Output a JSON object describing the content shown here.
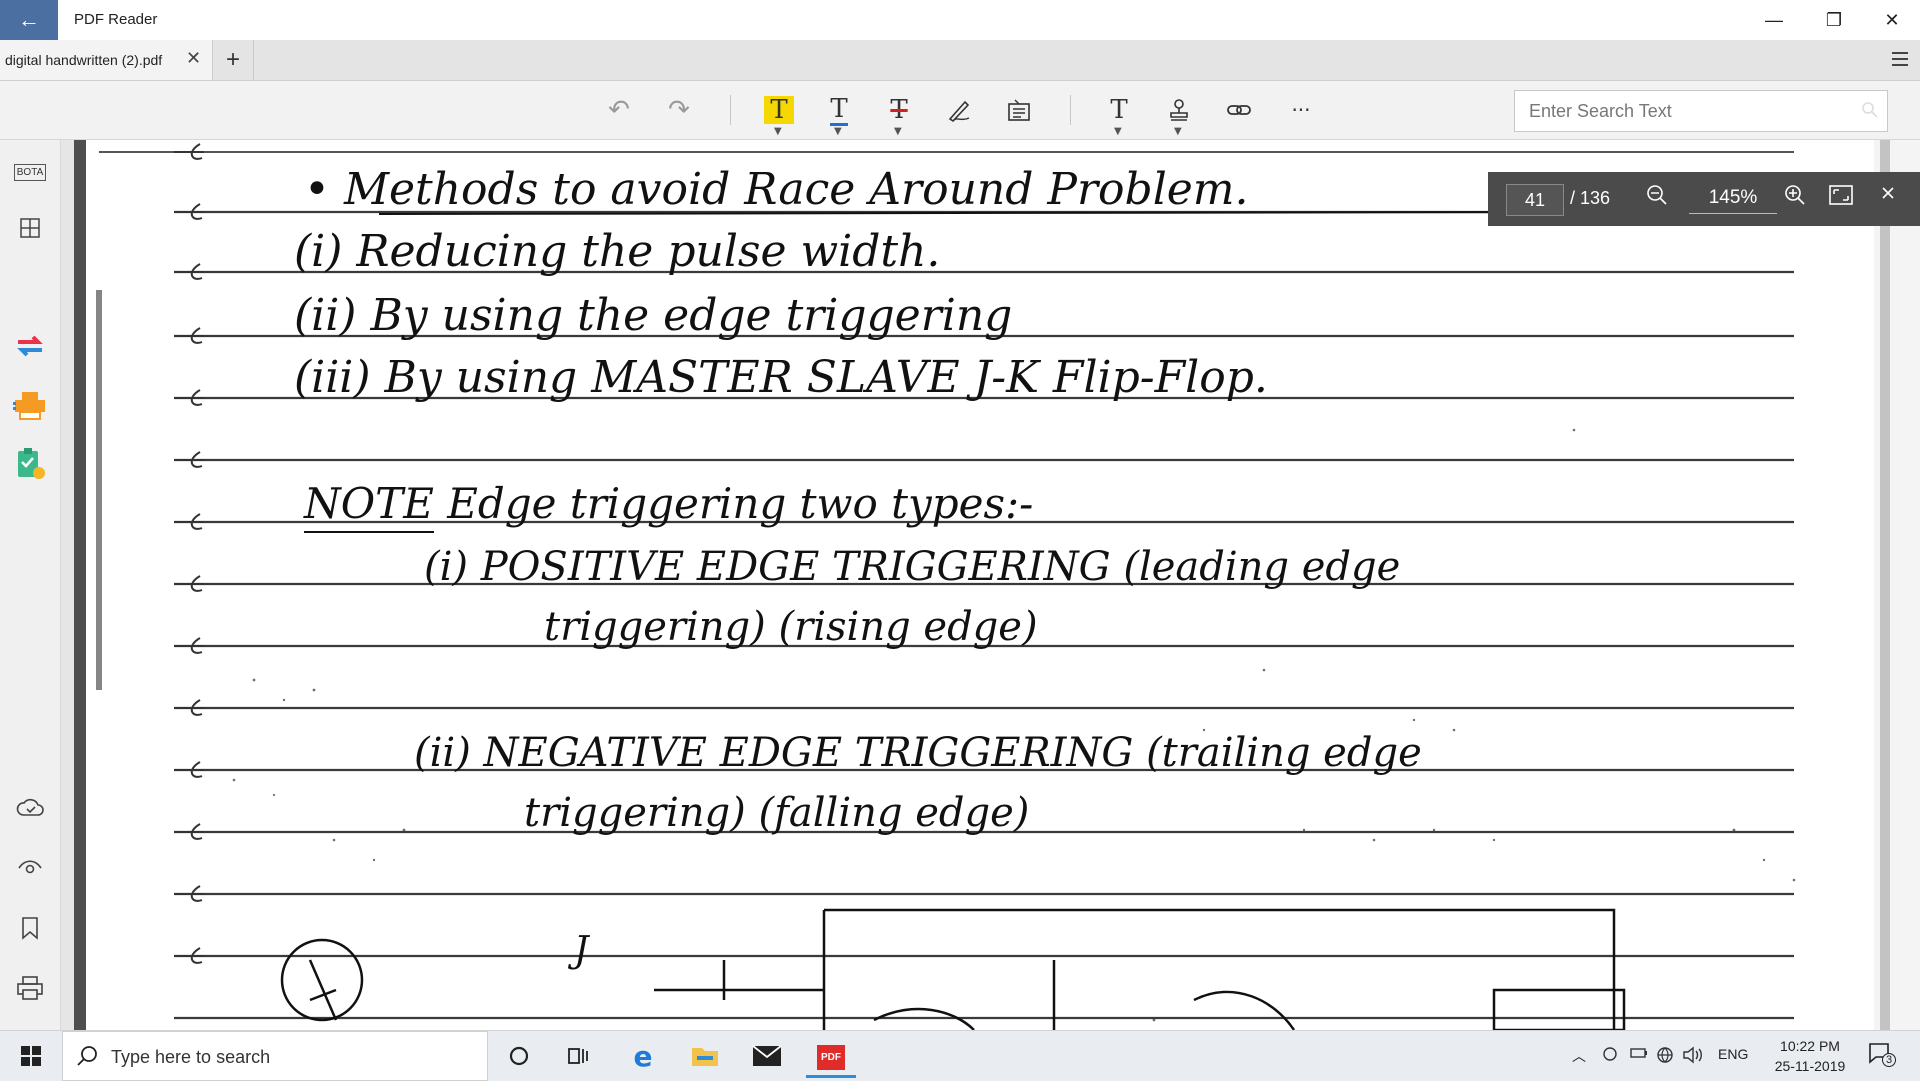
{
  "app": {
    "title": "PDF Reader",
    "back_glyph": "←"
  },
  "window_controls": {
    "minimize": "—",
    "maximize": "❐",
    "close": "✕"
  },
  "tabs": [
    {
      "label": "digital handwritten (2).pdf",
      "close": "✕"
    }
  ],
  "tab_add": "+",
  "toolbar": {
    "undo": "↶",
    "redo": "↷",
    "highlight": "T",
    "underline": "T",
    "strikethrough": "T",
    "text": "T",
    "more": "···",
    "colors": {
      "highlight": "#f5d800",
      "underline": "#1f6fd6",
      "strikethrough": "#d61f1f"
    }
  },
  "search": {
    "placeholder": "Enter Search Text"
  },
  "sidebar": {
    "bota": "BOTA"
  },
  "page_nav": {
    "current_page": "41",
    "total_pages": "/ 136",
    "zoom": "145%"
  },
  "document": {
    "lines": [
      "• Methods to avoid Race Around Problem.",
      "(i) Reducing the pulse width.",
      "(ii) By using the edge triggering",
      "(iii) By using MASTER SLAVE J-K Flip-Flop.",
      "NOTE Edge triggering two types:-",
      "(i) POSITIVE EDGE TRIGGERING (leading edge",
      "triggering) (rising edge)",
      "(ii) NEGATIVE EDGE TRIGGERING (trailing edge",
      "triggering) (falling edge)",
      "J"
    ]
  },
  "taskbar": {
    "search_placeholder": "Type here to search",
    "language": "ENG",
    "time": "10:22 PM",
    "date": "25-11-2019",
    "notifications": "3",
    "pdf_label": "PDF"
  }
}
